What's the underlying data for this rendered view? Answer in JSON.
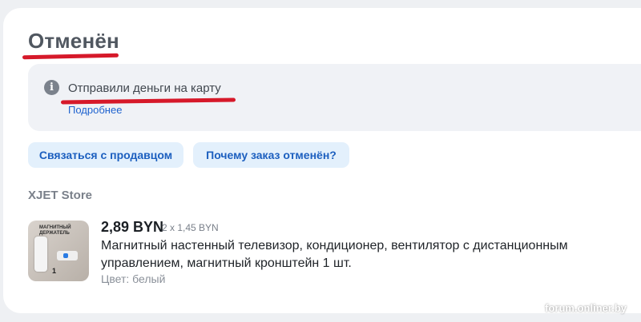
{
  "order": {
    "status": "Отменён"
  },
  "info": {
    "icon": "info-icon",
    "message": "Отправили деньги на карту",
    "more_link": "Подробнее"
  },
  "actions": {
    "contact_seller": "Связаться с продавцом",
    "why_cancelled": "Почему заказ отменён?"
  },
  "store": {
    "name": "XJET Store"
  },
  "product": {
    "price": "2,89 BYN",
    "price_detail": "2 x 1,45 BYN",
    "title": "Магнитный настенный телевизор, кондиционер, вентилятор с дистанционным управлением, магнитный кронштейн 1 шт.",
    "color": "Цвет: белый",
    "thumb_label": "МАГНИТНЫЙ ДЕРЖАТЕЛЬ",
    "thumb_number": "1"
  },
  "watermark": "forum.onliner.by",
  "colors": {
    "annotation": "#d6192a",
    "link": "#1f63cf",
    "pill_bg": "#e3f0fc",
    "info_bg": "#f0f2f6"
  }
}
